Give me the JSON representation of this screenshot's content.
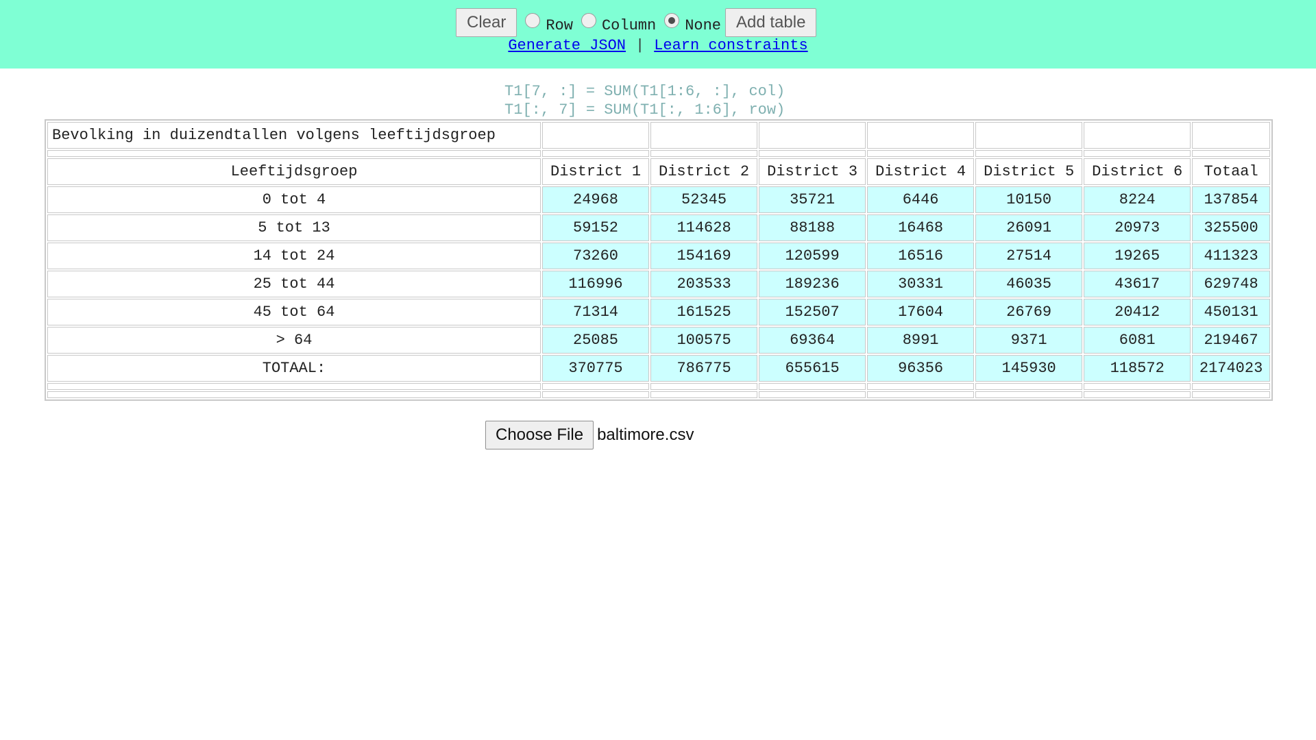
{
  "toolbar": {
    "clear_label": "Clear",
    "radios": [
      {
        "label": "Row",
        "checked": false
      },
      {
        "label": "Column",
        "checked": false
      },
      {
        "label": "None",
        "checked": true
      }
    ],
    "add_table_label": "Add table"
  },
  "links": {
    "generate_json": "Generate JSON",
    "separator": "|",
    "learn_constraints": "Learn constraints"
  },
  "constraints": [
    "T1[7, :] = SUM(T1[1:6, :], col)",
    "T1[:, 7] = SUM(T1[:, 1:6], row)"
  ],
  "table": {
    "title": "Bevolking in duizendtallen volgens leeftijdsgroep",
    "headers": [
      "Leeftijdsgroep",
      "District 1",
      "District 2",
      "District 3",
      "District 4",
      "District 5",
      "District 6",
      "Totaal"
    ],
    "rows": [
      [
        "0 tot 4",
        "24968",
        "52345",
        "35721",
        "6446",
        "10150",
        "8224",
        "137854"
      ],
      [
        "5 tot 13",
        "59152",
        "114628",
        "88188",
        "16468",
        "26091",
        "20973",
        "325500"
      ],
      [
        "14 tot 24",
        "73260",
        "154169",
        "120599",
        "16516",
        "27514",
        "19265",
        "411323"
      ],
      [
        "25 tot 44",
        "116996",
        "203533",
        "189236",
        "30331",
        "46035",
        "43617",
        "629748"
      ],
      [
        "45 tot 64",
        "71314",
        "161525",
        "152507",
        "17604",
        "26769",
        "20412",
        "450131"
      ],
      [
        "> 64",
        "25085",
        "100575",
        "69364",
        "8991",
        "9371",
        "6081",
        "219467"
      ],
      [
        "TOTAAL:",
        "370775",
        "786775",
        "655615",
        "96356",
        "145930",
        "118572",
        "2174023"
      ]
    ]
  },
  "file_input": {
    "button_label": "Choose File",
    "file_name": "baltimore.csv"
  },
  "colors": {
    "toolbar_bg": "#7fffd4",
    "numeric_cell_bg": "#ccffff",
    "constraint_text": "#7fb0b0"
  }
}
